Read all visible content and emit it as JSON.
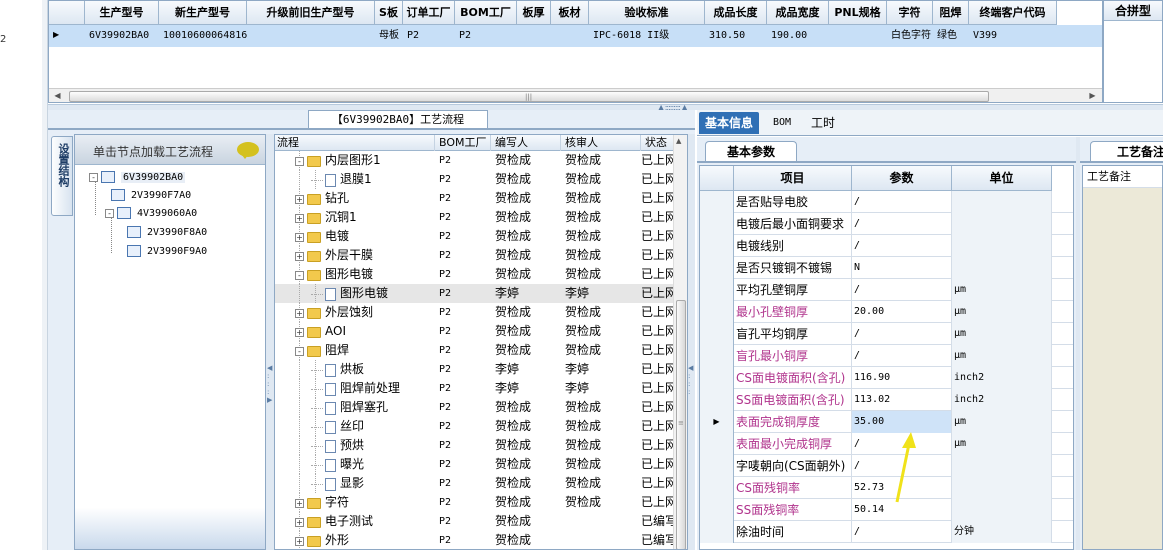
{
  "top_table": {
    "left_label": "2",
    "columns": [
      "生产型号",
      "新生产型号",
      "升级前旧生产型号",
      "S板",
      "订单工厂",
      "BOM工厂",
      "板厚",
      "板材",
      "验收标准",
      "成品长度",
      "成品宽度",
      "PNL规格",
      "字符",
      "阻焊",
      "终端客户代码"
    ],
    "row": [
      "6V39902BA0",
      "10010600064816",
      "",
      "母板",
      "P2",
      "P2",
      "",
      "",
      "IPC-6018 II级",
      "310.50",
      "190.00",
      "",
      "白色字符",
      "绿色",
      "V399"
    ],
    "right_panel_title": "合拼型"
  },
  "flow_panel": {
    "title": "【6V39902BA0】工艺流程",
    "vertical_tab": "设置结构",
    "hint": "单击节点加载工艺流程",
    "mini_tree": [
      "6V39902BA0",
      "2V3990F7A0",
      "4V399060A0",
      "2V3990F8A0",
      "2V3990F9A0"
    ],
    "columns": [
      "流程",
      "BOM工厂",
      "编写人",
      "核审人",
      "状态"
    ],
    "rows": [
      {
        "name": "内层图形1",
        "type": "folder",
        "exp": "-",
        "level": 1,
        "bom": "P2",
        "writer": "贺检成",
        "reviewer": "贺检成",
        "status": "已上网"
      },
      {
        "name": "退膜1",
        "type": "doc",
        "exp": "",
        "level": 2,
        "bom": "P2",
        "writer": "贺检成",
        "reviewer": "贺检成",
        "status": "已上网"
      },
      {
        "name": "钻孔",
        "type": "folder",
        "exp": "+",
        "level": 1,
        "bom": "P2",
        "writer": "贺检成",
        "reviewer": "贺检成",
        "status": "已上网"
      },
      {
        "name": "沉铜1",
        "type": "folder",
        "exp": "+",
        "level": 1,
        "bom": "P2",
        "writer": "贺检成",
        "reviewer": "贺检成",
        "status": "已上网"
      },
      {
        "name": "电镀",
        "type": "folder",
        "exp": "+",
        "level": 1,
        "bom": "P2",
        "writer": "贺检成",
        "reviewer": "贺检成",
        "status": "已上网"
      },
      {
        "name": "外层干膜",
        "type": "folder",
        "exp": "+",
        "level": 1,
        "bom": "P2",
        "writer": "贺检成",
        "reviewer": "贺检成",
        "status": "已上网"
      },
      {
        "name": "图形电镀",
        "type": "folder",
        "exp": "-",
        "level": 1,
        "bom": "P2",
        "writer": "贺检成",
        "reviewer": "贺检成",
        "status": "已上网"
      },
      {
        "name": "图形电镀",
        "type": "doc",
        "exp": "",
        "level": 2,
        "bom": "P2",
        "writer": "李婷",
        "reviewer": "李婷",
        "status": "已上网",
        "selected": true
      },
      {
        "name": "外层蚀刻",
        "type": "folder",
        "exp": "+",
        "level": 1,
        "bom": "P2",
        "writer": "贺检成",
        "reviewer": "贺检成",
        "status": "已上网"
      },
      {
        "name": "AOI",
        "type": "folder",
        "exp": "+",
        "level": 1,
        "bom": "P2",
        "writer": "贺检成",
        "reviewer": "贺检成",
        "status": "已上网"
      },
      {
        "name": "阻焊",
        "type": "folder",
        "exp": "-",
        "level": 1,
        "bom": "P2",
        "writer": "贺检成",
        "reviewer": "贺检成",
        "status": "已上网"
      },
      {
        "name": "烘板",
        "type": "doc",
        "exp": "",
        "level": 2,
        "bom": "P2",
        "writer": "李婷",
        "reviewer": "李婷",
        "status": "已上网"
      },
      {
        "name": "阻焊前处理",
        "type": "doc",
        "exp": "",
        "level": 2,
        "bom": "P2",
        "writer": "李婷",
        "reviewer": "李婷",
        "status": "已上网"
      },
      {
        "name": "阻焊塞孔",
        "type": "doc",
        "exp": "",
        "level": 2,
        "bom": "P2",
        "writer": "贺检成",
        "reviewer": "贺检成",
        "status": "已上网"
      },
      {
        "name": "丝印",
        "type": "doc",
        "exp": "",
        "level": 2,
        "bom": "P2",
        "writer": "贺检成",
        "reviewer": "贺检成",
        "status": "已上网"
      },
      {
        "name": "预烘",
        "type": "doc",
        "exp": "",
        "level": 2,
        "bom": "P2",
        "writer": "贺检成",
        "reviewer": "贺检成",
        "status": "已上网"
      },
      {
        "name": "曝光",
        "type": "doc",
        "exp": "",
        "level": 2,
        "bom": "P2",
        "writer": "贺检成",
        "reviewer": "贺检成",
        "status": "已上网"
      },
      {
        "name": "显影",
        "type": "doc",
        "exp": "",
        "level": 2,
        "bom": "P2",
        "writer": "贺检成",
        "reviewer": "贺检成",
        "status": "已上网"
      },
      {
        "name": "字符",
        "type": "folder",
        "exp": "+",
        "level": 1,
        "bom": "P2",
        "writer": "贺检成",
        "reviewer": "贺检成",
        "status": "已上网"
      },
      {
        "name": "电子测试",
        "type": "folder",
        "exp": "+",
        "level": 1,
        "bom": "P2",
        "writer": "贺检成",
        "reviewer": "",
        "status": "已编写"
      },
      {
        "name": "外形",
        "type": "folder",
        "exp": "+",
        "level": 1,
        "bom": "P2",
        "writer": "贺检成",
        "reviewer": "",
        "status": "已编写"
      }
    ]
  },
  "right_tabs": [
    "基本信息",
    "BOM",
    "工时"
  ],
  "basic_params": {
    "sub_tab": "基本参数",
    "columns": [
      "项目",
      "参数",
      "单位"
    ],
    "rows": [
      {
        "item": "是否贴导电胶",
        "value": "/",
        "unit": "",
        "pink": false
      },
      {
        "item": "电镀后最小面铜要求",
        "value": "/",
        "unit": "",
        "pink": false
      },
      {
        "item": "电镀线别",
        "value": "/",
        "unit": "",
        "pink": false
      },
      {
        "item": "是否只镀铜不镀锡",
        "value": "N",
        "unit": "",
        "pink": false
      },
      {
        "item": "平均孔壁铜厚",
        "value": "/",
        "unit": "μm",
        "pink": false
      },
      {
        "item": "最小孔壁铜厚",
        "value": "20.00",
        "unit": "μm",
        "pink": true
      },
      {
        "item": "盲孔平均铜厚",
        "value": "/",
        "unit": "μm",
        "pink": false
      },
      {
        "item": "盲孔最小铜厚",
        "value": "/",
        "unit": "μm",
        "pink": true
      },
      {
        "item": "CS面电镀面积(含孔)",
        "value": "116.90",
        "unit": "inch2",
        "pink": true
      },
      {
        "item": "SS面电镀面积(含孔)",
        "value": "113.02",
        "unit": "inch2",
        "pink": true
      },
      {
        "item": "表面完成铜厚度",
        "value": "35.00",
        "unit": "μm",
        "pink": true,
        "current": true
      },
      {
        "item": "表面最小完成铜厚",
        "value": "/",
        "unit": "μm",
        "pink": true
      },
      {
        "item": "字唛朝向(CS面朝外)",
        "value": "/",
        "unit": "",
        "pink": false
      },
      {
        "item": "CS面残铜率",
        "value": "52.73",
        "unit": "",
        "pink": true
      },
      {
        "item": "SS面残铜率",
        "value": "50.14",
        "unit": "",
        "pink": true
      },
      {
        "item": "除油时间",
        "value": "/",
        "unit": "分钟",
        "pink": false
      }
    ]
  },
  "remarks": {
    "tab": "工艺备注",
    "label": "工艺备注"
  },
  "colors": {
    "accent": "#2f6fb5",
    "pink_text": "#b0338c",
    "selected": "#c7dff7",
    "current": "#cfe3f8"
  }
}
